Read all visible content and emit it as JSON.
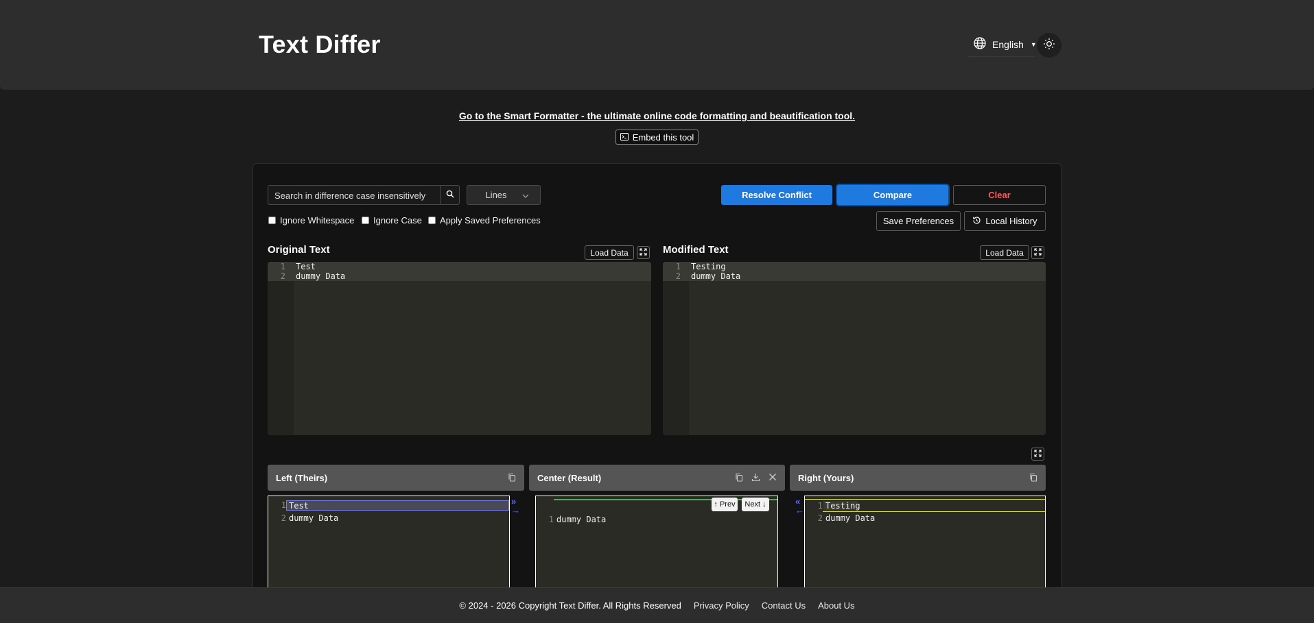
{
  "header": {
    "title": "Text Differ",
    "language": "English"
  },
  "promo": {
    "link": "Go to the Smart Formatter - the ultimate online code formatting and beautification tool.",
    "embed": "Embed this tool"
  },
  "toolbar": {
    "search_placeholder": "Search in difference case insensitively",
    "mode": "Lines",
    "resolve": "Resolve Conflict",
    "compare": "Compare",
    "clear": "Clear",
    "save_prefs": "Save Preferences",
    "history": "Local History",
    "options": [
      "Ignore Whitespace",
      "Ignore Case",
      "Apply Saved Preferences"
    ]
  },
  "editors": {
    "original": {
      "title": "Original Text",
      "load": "Load Data",
      "lines": [
        "Test",
        "dummy Data"
      ]
    },
    "modified": {
      "title": "Modified Text",
      "load": "Load Data",
      "lines": [
        "Testing",
        "dummy Data"
      ]
    }
  },
  "merge": {
    "left": {
      "title": "Left (Theirs)",
      "lines": [
        "Test",
        "dummy Data"
      ]
    },
    "center": {
      "title": "Center (Result)",
      "lines": [
        "dummy Data"
      ],
      "prev": "↑ Prev",
      "next": "Next ↓"
    },
    "right": {
      "title": "Right (Yours)",
      "lines": [
        "Testing",
        "dummy Data"
      ]
    }
  },
  "footer": {
    "copyright": "© 2024 - 2026 Copyright Text Differ. All Rights Reserved",
    "links": [
      "Privacy Policy",
      "Contact Us",
      "About Us"
    ]
  },
  "colors": {
    "accent": "#1f7ae0",
    "danger": "#ff5a5a",
    "editor_bg": "#2b2b25"
  }
}
